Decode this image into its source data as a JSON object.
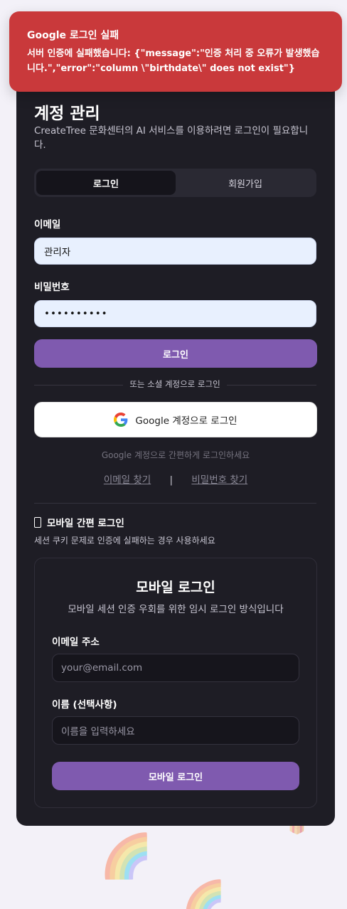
{
  "toast": {
    "title": "Google 로그인 실패",
    "message": "서버 인증에 실패했습니다: {\"message\":\"인증 처리 중 오류가 발생했습니다.\",\"error\":\"column \\\"birthdate\\\" does not exist\"}"
  },
  "card": {
    "title": "계정 관리",
    "subtitle": "CreateTree 문화센터의 AI 서비스를 이용하려면 로그인이 필요합니다.",
    "tabs": [
      {
        "label": "로그인",
        "active": true
      },
      {
        "label": "회원가입",
        "active": false
      }
    ],
    "email_label": "이메일",
    "email_value": "관리자",
    "password_label": "비밀번호",
    "password_value": "••••••••••",
    "login_button": "로그인",
    "divider_text": "또는 소셜 계정으로 로그인",
    "google_button": "Google 계정으로 로그인",
    "google_hint": "Google 계정으로 간편하게 로그인하세요",
    "find_email": "이메일 찾기",
    "separator": "|",
    "find_password": "비밀번호 찾기"
  },
  "mobile": {
    "heading": "모바일 간편 로그인",
    "description": "세션 쿠키 문제로 인증에 실패하는 경우 사용하세요",
    "title": "모바일 로그인",
    "subtitle": "모바일 세션 인증 우회를 위한 임시 로그인 방식입니다",
    "email_label": "이메일 주소",
    "email_placeholder": "your@email.com",
    "name_label": "이름 (선택사항)",
    "name_placeholder": "이름을 입력하세요",
    "button": "모바일 로그인"
  },
  "colors": {
    "toast_bg": "#c9393b",
    "card_bg": "#1e1d25",
    "accent": "#7f5aaf",
    "input_light": "#e8f0fe"
  }
}
